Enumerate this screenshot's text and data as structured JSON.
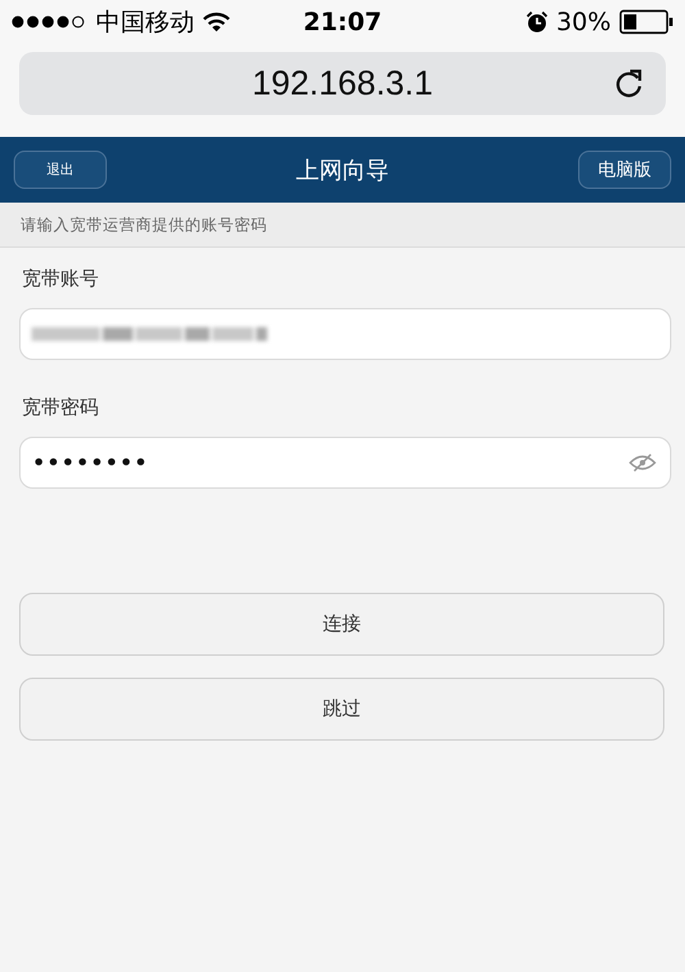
{
  "status_bar": {
    "carrier": "中国移动",
    "time": "21:07",
    "battery": "30%"
  },
  "address_bar": {
    "url": "192.168.3.1"
  },
  "header": {
    "left_button": "退出",
    "title": "上网向导",
    "right_button": "电脑版"
  },
  "notice": "请输入宽带运营商提供的账号密码",
  "fields": [
    {
      "label": "宽带账号",
      "kind": "blurred"
    },
    {
      "label": "宽带密码",
      "kind": "password",
      "value": "••••••••"
    }
  ],
  "buttons": [
    "连接",
    "跳过"
  ]
}
